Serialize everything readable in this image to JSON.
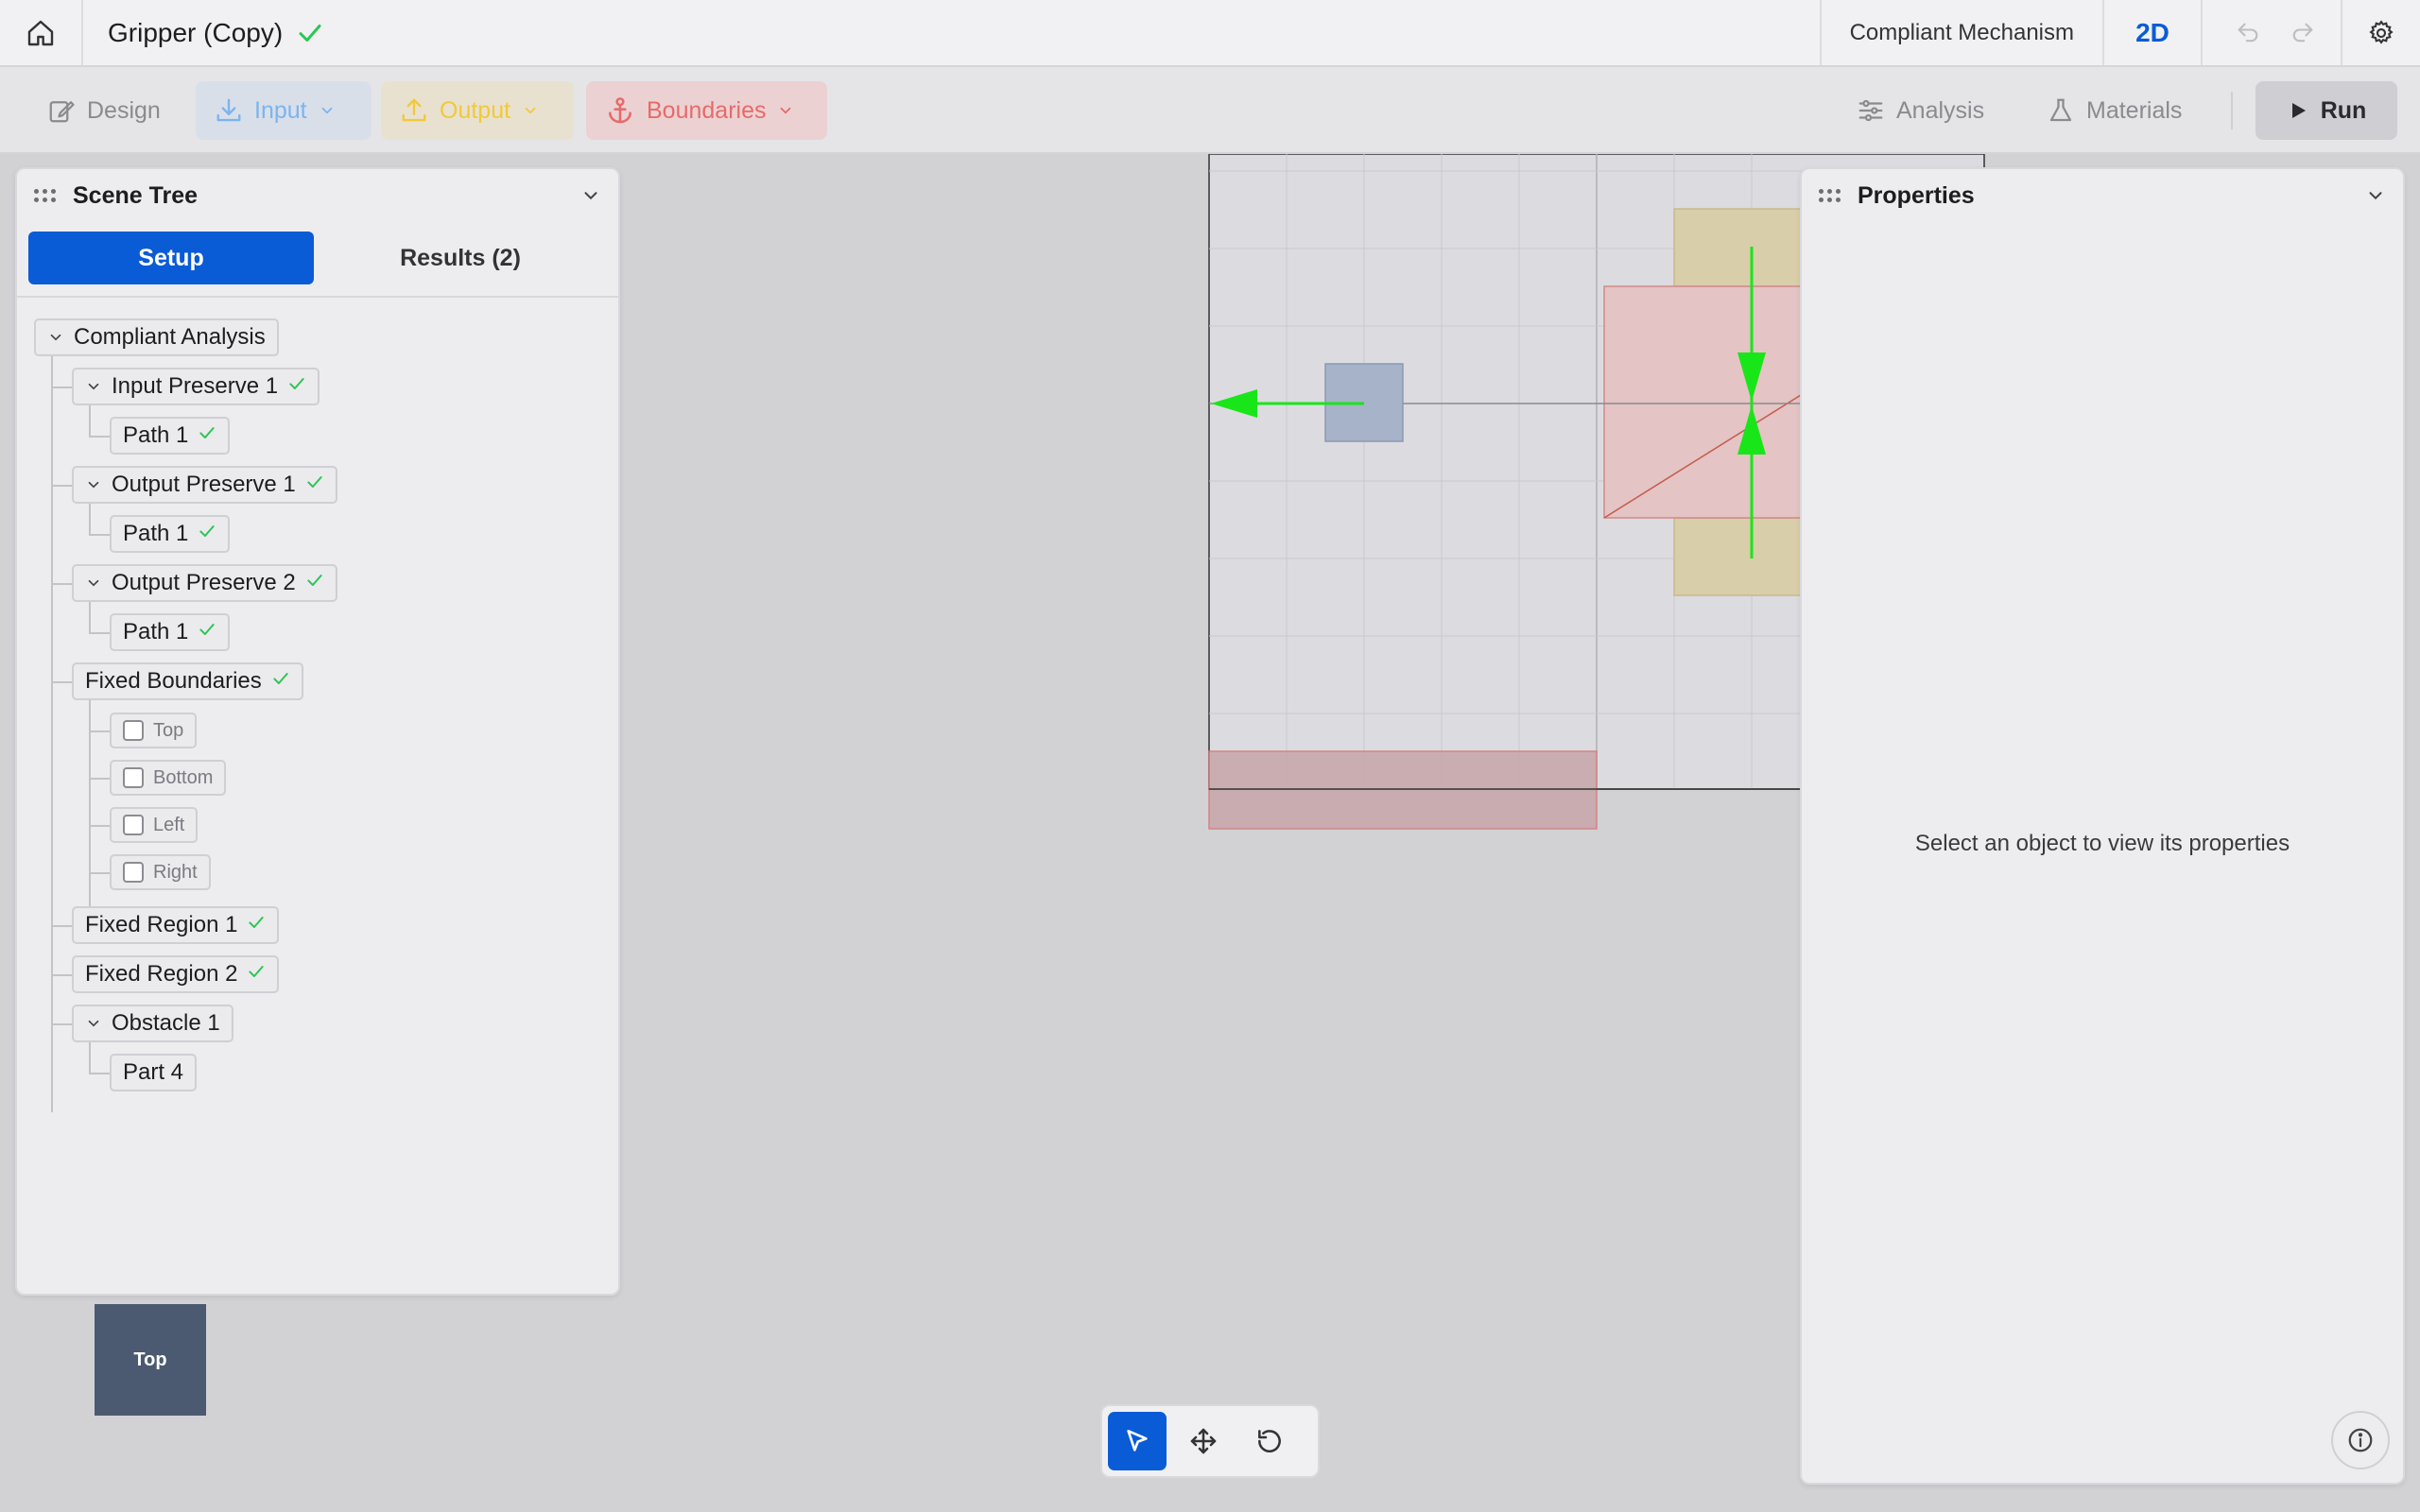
{
  "header": {
    "title": "Gripper (Copy)",
    "mode": "Compliant Mechanism",
    "dimension": "2D"
  },
  "toolbar": {
    "design": "Design",
    "input": "Input",
    "output": "Output",
    "boundaries": "Boundaries",
    "analysis": "Analysis",
    "materials": "Materials",
    "run": "Run"
  },
  "colors": {
    "accent": "#0a5bd6",
    "check": "#2dc653",
    "input": "#7cb4ee",
    "output": "#f1c93a",
    "boundaries": "#e76a6a",
    "arrow": "#19e619"
  },
  "scene_tree": {
    "title": "Scene Tree",
    "tabs": {
      "setup": "Setup",
      "results": "Results (2)"
    },
    "nodes": {
      "root": "Compliant Analysis",
      "input_preserve_1": "Input Preserve 1",
      "input_path": "Path 1",
      "output_preserve_1": "Output Preserve 1",
      "output_path_1": "Path 1",
      "output_preserve_2": "Output Preserve 2",
      "output_path_2": "Path 1",
      "fixed_boundaries": "Fixed Boundaries",
      "top": "Top",
      "bottom": "Bottom",
      "left": "Left",
      "right": "Right",
      "fixed_region_1": "Fixed Region 1",
      "fixed_region_2": "Fixed Region 2",
      "obstacle_1": "Obstacle 1",
      "part_4": "Part 4"
    }
  },
  "properties": {
    "title": "Properties",
    "empty_message": "Select an object to view its properties"
  },
  "view_cube": {
    "label": "Top"
  },
  "icons": [
    "home-icon",
    "check-icon",
    "undo-icon",
    "redo-icon",
    "gear-icon",
    "pencil-icon",
    "download-icon",
    "upload-icon",
    "anchor-icon",
    "sliders-icon",
    "flask-icon",
    "play-icon",
    "grip-icon",
    "chevron-down-icon",
    "info-icon",
    "pointer-icon",
    "move-icon",
    "rotate-icon"
  ]
}
